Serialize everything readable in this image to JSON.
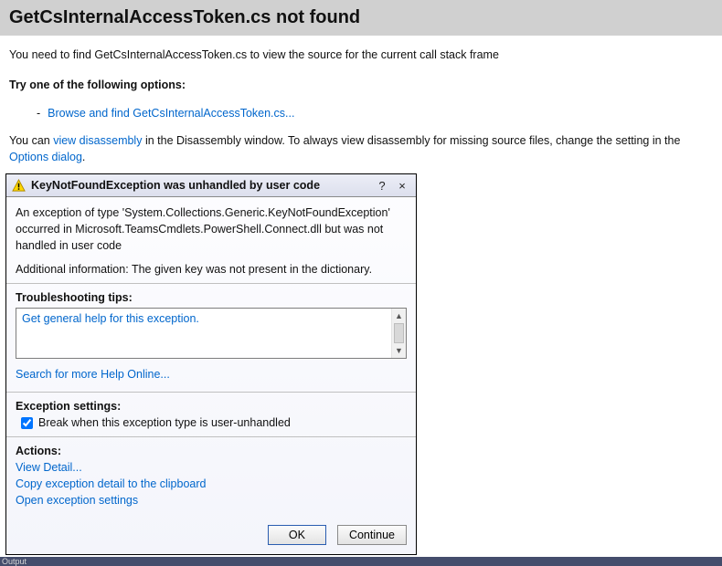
{
  "header": {
    "title": "GetCsInternalAccessToken.cs not found"
  },
  "body": {
    "intro": "You need to find GetCsInternalAccessToken.cs to view the source for the current call stack frame",
    "options_label": "Try one of the following options:",
    "browse_link": "Browse and find GetCsInternalAccessToken.cs...",
    "disasm_pre": "You can ",
    "disasm_link": "view disassembly",
    "disasm_mid": " in the Disassembly window. To always view disassembly for missing source files, change the setting in the ",
    "options_dialog_link": "Options dialog",
    "disasm_post": "."
  },
  "dialog": {
    "title": "KeyNotFoundException was unhandled by user code",
    "help_glyph": "?",
    "close_glyph": "×",
    "message": "An exception of type 'System.Collections.Generic.KeyNotFoundException' occurred in Microsoft.TeamsCmdlets.PowerShell.Connect.dll but was not handled in user code",
    "additional_label": "Additional information:",
    "additional_text": "The given key was not present in the dictionary.",
    "tips_label": "Troubleshooting tips:",
    "tips_item": "Get general help for this exception.",
    "search_link": "Search for more Help Online...",
    "settings_label": "Exception settings:",
    "settings_checkbox_label": "Break when this exception type is user-unhandled",
    "settings_checked": true,
    "actions_label": "Actions:",
    "action_view_detail": "View Detail...",
    "action_copy": "Copy exception detail to the clipboard",
    "action_open_settings": "Open exception settings",
    "btn_ok": "OK",
    "btn_continue": "Continue"
  },
  "bottom": {
    "text": "Output"
  }
}
